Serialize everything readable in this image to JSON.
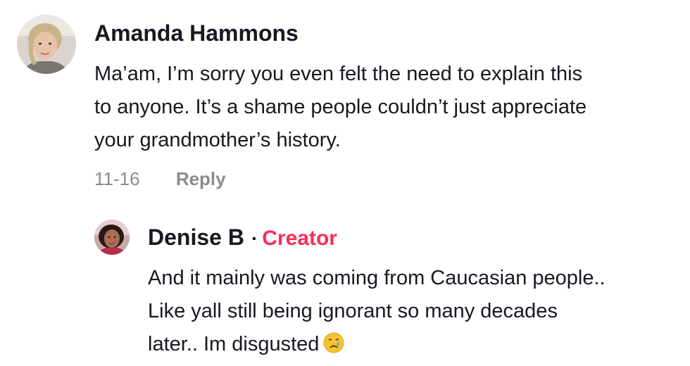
{
  "comments": [
    {
      "author": "Amanda Hammons",
      "text_lines": [
        "Ma’am, I’m sorry you even felt the need to explain this",
        "to anyone. It’s a shame people couldn’t just appreciate",
        "your grandmother’s history."
      ],
      "date": "11-16",
      "reply_label": "Reply"
    },
    {
      "author": "Denise B",
      "separator": "·",
      "badge": "Creator",
      "text_lines": [
        "And it mainly was coming from Caucasian people..",
        "Like yall still being ignorant so many decades",
        "later.. Im disgusted"
      ],
      "emoji": "crying-face-icon"
    }
  ],
  "colors": {
    "text": "#161823",
    "secondary": "#8a8b91",
    "creator": "#fe2c55"
  }
}
